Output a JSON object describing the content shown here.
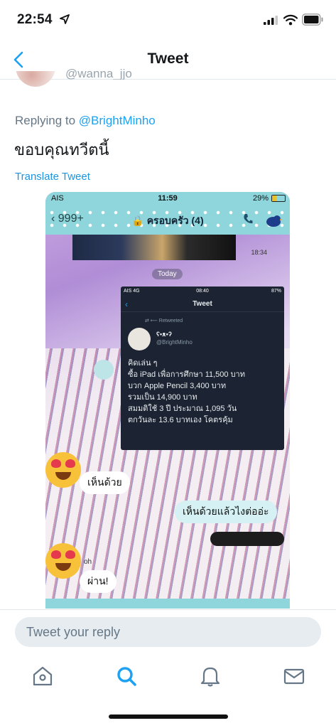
{
  "status_bar": {
    "time": "22:54"
  },
  "nav": {
    "title": "Tweet"
  },
  "tweet": {
    "handle_fragment": "@wanna_jjo",
    "replying_prefix": "Replying to",
    "replying_mention": "@BrightMinho",
    "text": "ขอบคุณทวีตนี้",
    "translate_label": "Translate Tweet"
  },
  "embedded_screenshot": {
    "status": {
      "carrier": "AIS",
      "time": "11:59",
      "battery": "29%"
    },
    "header": {
      "back_count": "999+",
      "group_name": "ครอบครัว (4)"
    },
    "chat_time": "18:34",
    "today_label": "Today",
    "inner_tweet": {
      "status": {
        "carrier": "AIS 4G",
        "time": "08:40",
        "battery": "87%"
      },
      "title": "Tweet",
      "retweeted_label": "Retweeted",
      "user_name": "ʕ•ᴥ•ʔ",
      "user_handle": "@BrightMinho",
      "body_lines": [
        "คิดเล่น ๆ",
        "ซื้อ iPad เพื่อการศึกษา 11,500 บาท",
        "บวก Apple Pencil 3,400 บาท",
        "รวมเป็น 14,900 บาท",
        "สมมติใช้ 3 ปี ประมาณ 1,095 วัน",
        "ตกวันละ 13.6 บาทเอง โคตรคุ้ม"
      ]
    },
    "bubbles": {
      "reply_1": "เห็นด้วย",
      "reply_2": "เห็นด้วยแล้วไงต่ออ่ะ",
      "reply_3": "ผ่าน!"
    },
    "sender_tag": "oh"
  },
  "reply": {
    "placeholder": "Tweet your reply"
  },
  "tabs": [
    "home-icon",
    "search-icon",
    "notifications-icon",
    "messages-icon"
  ],
  "colors": {
    "accent": "#1da1f2",
    "chat_theme": "#8fd6dc",
    "inner_tweet_bg": "#1c2433"
  }
}
